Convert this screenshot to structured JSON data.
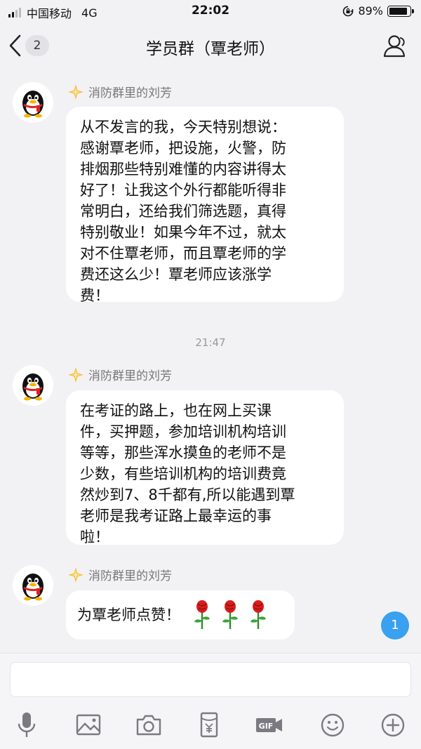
{
  "status_bar": {
    "carrier": "中国移动",
    "network": "4G",
    "time": "22:02",
    "battery_percent": "89%",
    "battery_level": 0.89
  },
  "nav": {
    "unread_count": "2",
    "title": "学员群（覃老师）"
  },
  "messages": [
    {
      "sender": "消防群里的刘芳",
      "text": "从不发言的我，今天特别想说：\n感谢覃老师，把设施，火警，防\n排烟那些特别难懂的内容讲得太\n好了！让我这个外行都能听得非\n常明白，还给我们筛选题，真得\n特别敬业！如果今年不过，就太\n对不住覃老师，而且覃老师的学\n费还这么少！覃老师应该涨学\n费！"
    },
    {
      "sender": "消防群里的刘芳",
      "text": "在考证的路上，也在网上买课\n件，买押题，参加培训机构培训\n等等，那些浑水摸鱼的老师不是\n少数，有些培训机构的培训费竟\n然炒到7、8千都有,所以能遇到覃\n老师是我考证路上最幸运的事\n啦！"
    },
    {
      "sender": "消防群里的刘芳",
      "text": "为覃老师点赞！",
      "emoji": [
        "rose-icon",
        "rose-icon",
        "rose-icon"
      ]
    }
  ],
  "timestamp": "21:47",
  "new_message_badge": "1",
  "colors": {
    "background": "#f2f2f5",
    "bubble": "#ffffff",
    "badge": "#3aa0f0",
    "sender_name": "#777777"
  },
  "toolbar_icons": [
    "microphone-icon",
    "image-icon",
    "camera-icon",
    "red-packet-icon",
    "gif-icon",
    "emoji-icon",
    "plus-icon"
  ]
}
